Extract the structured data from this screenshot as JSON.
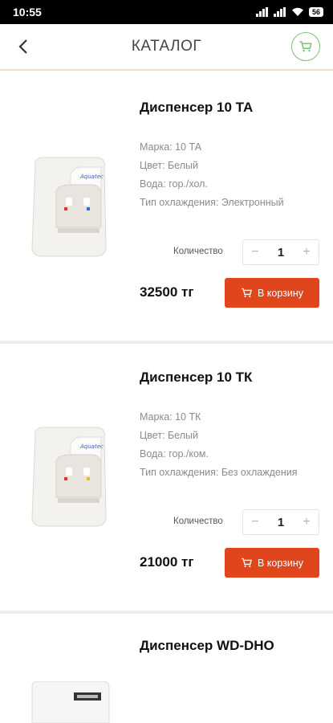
{
  "status": {
    "time": "10:55",
    "battery": "56"
  },
  "header": {
    "title": "КАТАЛОГ"
  },
  "products": [
    {
      "name": "Диспенсер 10 ТА",
      "brand": "Марка: 10 ТА",
      "color": "Цвет: Белый",
      "water": "Вода: гор./хол.",
      "cooling": "Тип охлаждения: Электронный",
      "qty_label": "Количество",
      "qty": "1",
      "price": "32500 тг",
      "button": "В корзину",
      "tap_colors": [
        "#e03030",
        "#2f6fd6"
      ]
    },
    {
      "name": "Диспенсер 10 ТК",
      "brand": "Марка: 10 ТК",
      "color": "Цвет: Белый",
      "water": "Вода: гор./ком.",
      "cooling": "Тип охлаждения: Без охлаждения",
      "qty_label": "Количество",
      "qty": "1",
      "price": "21000 тг",
      "button": "В корзину",
      "tap_colors": [
        "#e03030",
        "#e0c030"
      ]
    },
    {
      "name": "Диспенсер WD-DHO"
    }
  ],
  "controls": {
    "minus": "−",
    "plus": "+"
  },
  "colors": {
    "accent": "#e0451b",
    "cart_green": "#7cc17a"
  }
}
